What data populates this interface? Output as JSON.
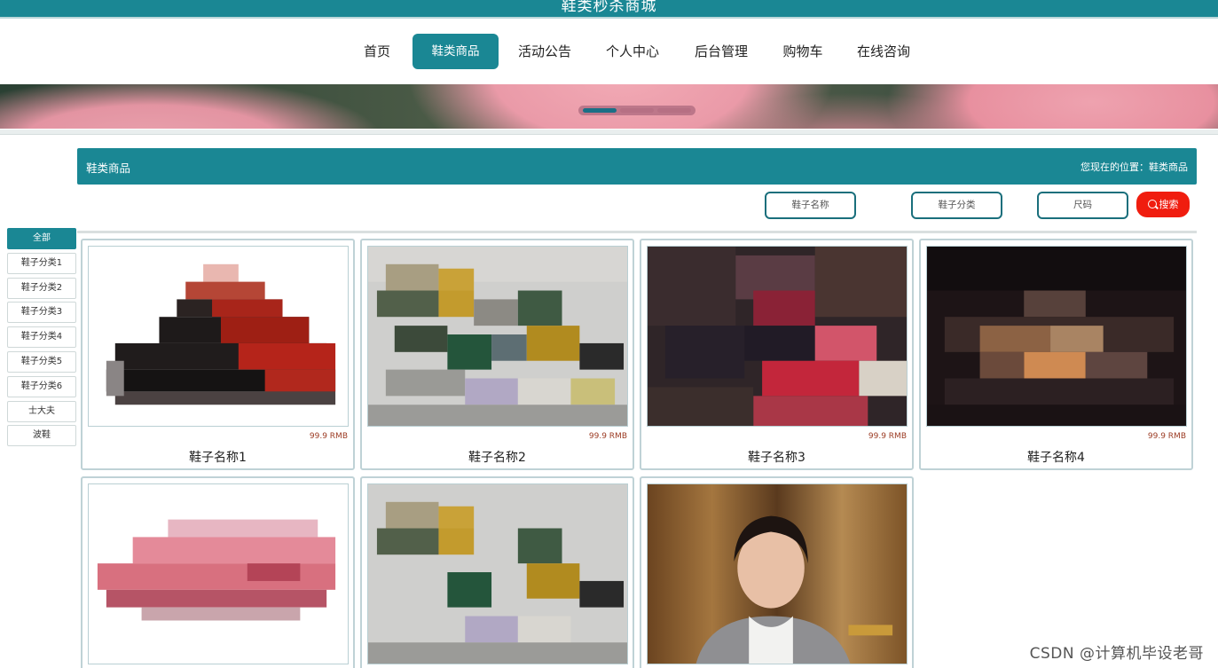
{
  "site": {
    "title": "鞋类秒杀商城"
  },
  "nav": {
    "items": [
      "首页",
      "鞋类商品",
      "活动公告",
      "个人中心",
      "后台管理",
      "购物车",
      "在线咨询"
    ],
    "active": "鞋类商品"
  },
  "section": {
    "title": "鞋类商品",
    "breadcrumb": "您现在的位置：鞋类商品"
  },
  "search": {
    "name_placeholder": "鞋子名称",
    "category_placeholder": "鞋子分类",
    "size_placeholder": "尺码",
    "button_label": "搜索"
  },
  "categories": [
    "全部",
    "鞋子分类1",
    "鞋子分类2",
    "鞋子分类3",
    "鞋子分类4",
    "鞋子分类5",
    "鞋子分类6",
    "士大夫",
    "波鞋"
  ],
  "products": [
    {
      "name": "鞋子名称1",
      "price": "99.9 RMB"
    },
    {
      "name": "鞋子名称2",
      "price": "99.9 RMB"
    },
    {
      "name": "鞋子名称3",
      "price": "99.9 RMB"
    },
    {
      "name": "鞋子名称4",
      "price": "99.9 RMB"
    },
    {
      "name": "",
      "price": ""
    },
    {
      "name": "",
      "price": ""
    },
    {
      "name": "",
      "price": ""
    }
  ],
  "watermark": "CSDN @计算机毕设老哥",
  "colors": {
    "primary": "#1a8794",
    "search_button": "#f01d0f",
    "price": "#9b3a22"
  }
}
